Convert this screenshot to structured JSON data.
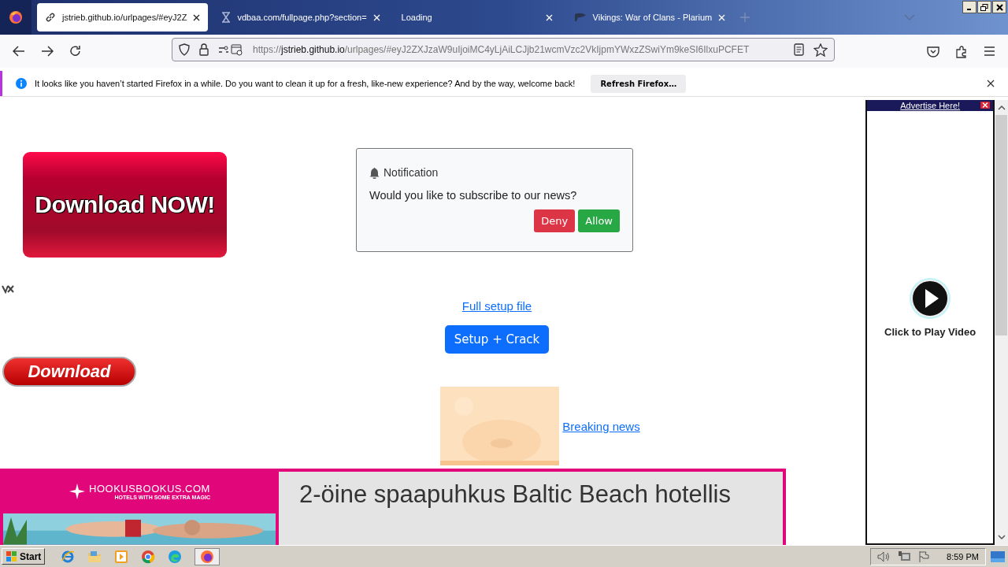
{
  "browser": {
    "tabs": [
      {
        "title": "jstrieb.github.io/urlpages/#eyJ2Z",
        "selected": true,
        "kind": "link"
      },
      {
        "title": "vdbaa.com/fullpage.php?section=",
        "selected": false,
        "kind": "hourglass"
      },
      {
        "title": "Loading",
        "selected": false,
        "kind": "none"
      },
      {
        "title": "Vikings: War of Clans - Plarium",
        "selected": false,
        "kind": "plarium"
      }
    ],
    "url_parts": [
      "https://",
      "jstrieb.github.io",
      "/urlpages/#eyJ2ZXJzaW9uIjoiMC4yLjAiLCJjb21wcmVzc2VkIjpmYWxzZSwiYm9keSI6IlxuPCFET"
    ]
  },
  "infobar": {
    "message": "It looks like you haven’t started Firefox in a while. Do you want to clean it up for a fresh, like-new experience? And by the way, welcome back!",
    "button": "Refresh Firefox…"
  },
  "page": {
    "download_now": "Download NOW!",
    "download": "Download",
    "notification": {
      "title": "Notification",
      "message": "Would you like to subscribe to our news?",
      "buttons": [
        {
          "label": "Deny",
          "kind": "danger"
        },
        {
          "label": "Allow",
          "kind": "success"
        }
      ]
    },
    "full_setup": "Full setup file",
    "setup_button": "Setup + Crack",
    "breaking": "Breaking news"
  },
  "side_ad": {
    "header": "Advertise Here!",
    "caption": "Click to Play Video"
  },
  "bottom_ad": {
    "brand": "HOOKUSBOOKUS.COM",
    "tagline": "HOTELS WITH SOME EXTRA MAGIC",
    "headline": "2-öine spaapuhkus Baltic Beach hotellis"
  },
  "taskbar": {
    "start": "Start",
    "clock": "8:59 PM"
  }
}
